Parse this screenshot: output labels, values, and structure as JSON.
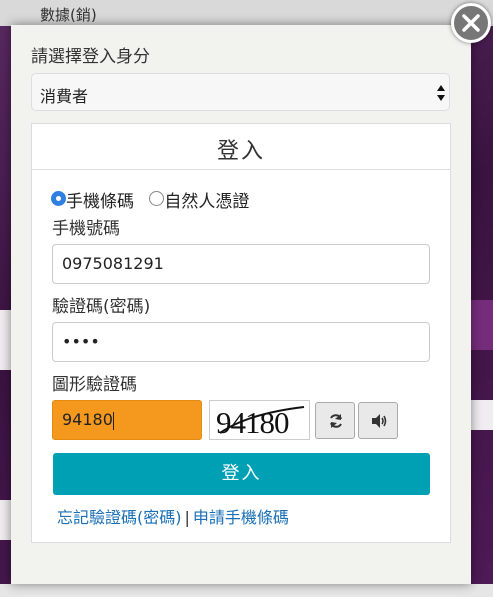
{
  "background": {
    "header_text": "數據(銷)"
  },
  "modal": {
    "role_label": "請選擇登入身分",
    "role_select_value": "消費者",
    "panel_title": "登入",
    "login_methods": [
      "手機條碼",
      "自然人憑證"
    ],
    "selected_method_index": 0,
    "phone_label": "手機號碼",
    "phone_value": "0975081291",
    "password_label": "驗證碼(密碼)",
    "password_value": "••••",
    "captcha_label": "圖形驗證碼",
    "captcha_value": "94180",
    "captcha_image_text": "94180",
    "submit_label": "登入",
    "forgot_link": "忘記驗證碼(密碼)",
    "link_separator": "|",
    "apply_link": "申請手機條碼"
  },
  "colors": {
    "submit_button": "#00a0b4",
    "captcha_input_bg": "#f4991e",
    "link": "#1a6fb5",
    "radio_checked": "#2f7fe0"
  },
  "icons": {
    "close": "close-icon",
    "refresh": "refresh-icon",
    "audio": "speaker-icon",
    "select_arrows": "select-arrows-icon"
  }
}
